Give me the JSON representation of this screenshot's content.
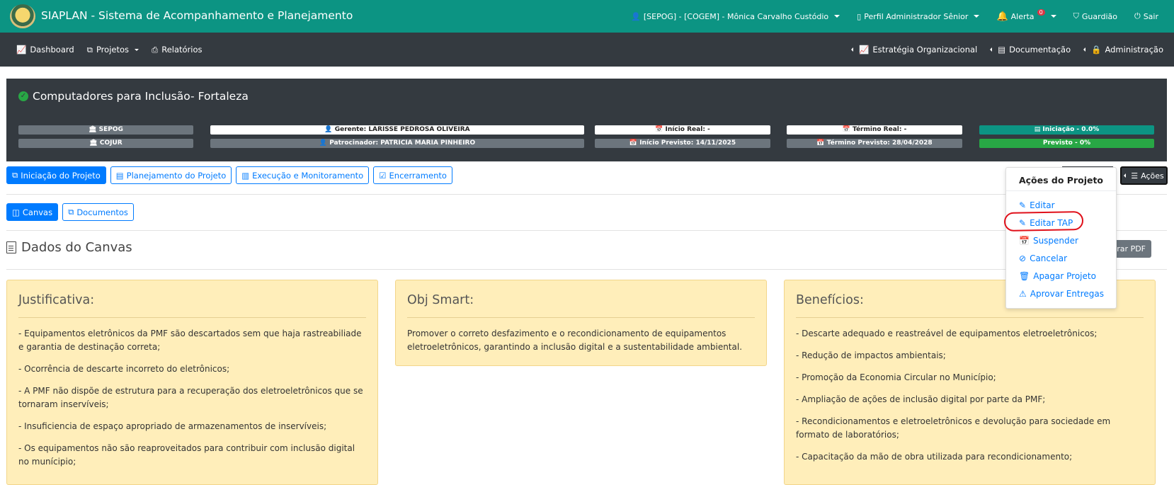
{
  "topbar": {
    "app_title": "SIAPLAN - Sistema de Acompanhamento e Planejamento",
    "user": "[SEPOG] - [COGEM] - Mônica Carvalho Custódio",
    "profile": "Perfil Administrador Sênior",
    "alert_label": "Alerta",
    "alert_count": "0",
    "guardian": "Guardião",
    "exit": "Sair"
  },
  "nav": {
    "left": [
      "Dashboard",
      "Projetos",
      "Relatórios"
    ],
    "right": [
      "Estratégia Organizacional",
      "Documentação",
      "Administração"
    ]
  },
  "project": {
    "title": "Computadores para Inclusão- Fortaleza",
    "org1": "SEPOG",
    "org2": "COJUR",
    "manager": "Gerente: LARISSE PEDROSA OLIVEIRA",
    "sponsor": "Patrocinador: PATRICIA MARIA PINHEIRO",
    "start_real": "Início Real: -",
    "start_planned": "Início Previsto: 14/11/2025",
    "end_real": "Término Real: -",
    "end_planned": "Término Previsto: 28/04/2028",
    "progress_real": "Iniciação - 0.0%",
    "progress_planned": "Previsto - 0%"
  },
  "phase_tabs": [
    "Iniciação do Projeto",
    "Planejamento do Projeto",
    "Execução e Monitoramento",
    "Encerramento"
  ],
  "sub_tabs": [
    "Canvas",
    "Documentos"
  ],
  "actions": {
    "button": "Ações",
    "menu_title": "Ações do Projeto",
    "items": [
      "Editar",
      "Editar TAP",
      "Suspender",
      "Cancelar",
      "Apagar Projeto",
      "Aprovar Entregas"
    ]
  },
  "section_title": "Dados do Canvas",
  "gerar_pdf": "erar PDF",
  "cards": {
    "justificativa": {
      "title": "Justificativa:",
      "items": [
        "- Equipamentos eletrônicos da PMF são descartados sem que haja rastreabiliade e garantia de destinação correta;",
        "- Ocorrência de descarte incorreto do eletrônicos;",
        "- A PMF não dispõe de estrutura para a recuperação dos eletroeletrônicos que se tornaram inservíveis;",
        "- Insuficiencia de espaço apropriado de armazenamentos de inservíveis;",
        "- Os equipamentos não são reaproveitados para contribuir com inclusão digital no munícipio;"
      ]
    },
    "obj_smart": {
      "title": "Obj Smart:",
      "items": [
        "Promover o correto desfazimento e o recondicionamento de equipamentos eletroeletrônicos, garantindo a inclusão digital e a sustentabilidade ambiental."
      ]
    },
    "beneficios": {
      "title": "Benefícios:",
      "items": [
        "- Descarte adequado e reastreável de equipamentos eletroeletrônicos;",
        "- Redução de impactos ambientais;",
        "- Promoção da Economia Circular no Município;",
        "- Ampliação de ações de inclusão digital por parte da PMF;",
        "- Recondicionamentos e eletroeletrônicos e devolução para sociedade em formato de laboratórios;",
        "- Capacitação da mão de obra utilizada para recondicionamento;"
      ]
    }
  }
}
